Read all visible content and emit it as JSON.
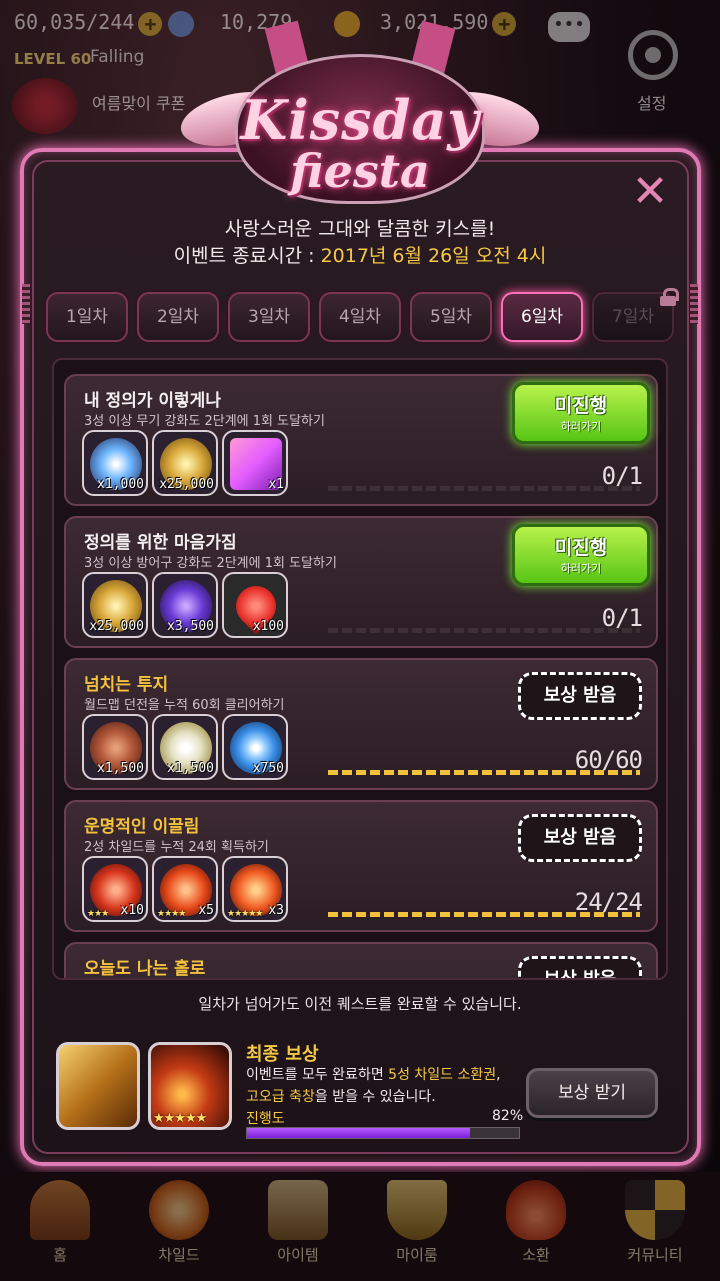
{
  "hud": {
    "resource1": "60,035/244",
    "resource2": "10,279",
    "resource3": "3,021,590",
    "level_label": "LEVEL 60",
    "player_name": "Falling",
    "event_banner": "여름맞이 쿠폰",
    "settings_label": "설정"
  },
  "event": {
    "logo_line1": "Kissday",
    "logo_line2": "fiesta",
    "subtitle": "사랑스러운 그대와 달콤한 키스를!",
    "end_label": "이벤트 종료시간 : ",
    "end_time": "2017년 6월 26일 오전 4시",
    "close_symbol": "✕"
  },
  "tabs": [
    {
      "label": "1일차",
      "state": "normal"
    },
    {
      "label": "2일차",
      "state": "normal"
    },
    {
      "label": "3일차",
      "state": "normal"
    },
    {
      "label": "4일차",
      "state": "normal"
    },
    {
      "label": "5일차",
      "state": "normal"
    },
    {
      "label": "6일차",
      "state": "active"
    },
    {
      "label": "7일차",
      "state": "locked"
    }
  ],
  "quests": [
    {
      "title": "내 정의가 이렇게나",
      "desc": "3성 이상 무기 강화도 2단계에 1회 도달하기",
      "status": "incomplete",
      "button": {
        "main": "미진행",
        "sub": "하러가기"
      },
      "progress_text": "0/1",
      "progress": 0,
      "rewards": [
        {
          "icon": "rainbow-gem-icon",
          "count": "x1,000",
          "color": "#6fb6ff"
        },
        {
          "icon": "gold-coins-icon",
          "count": "x25,000",
          "color": "#d9a83a"
        },
        {
          "icon": "ticket-card-icon",
          "count": "x1",
          "color": "#e45cff"
        }
      ]
    },
    {
      "title": "정의를 위한 마음가짐",
      "desc": "3성 이상 방어구 강화도 2단계에 1회 도달하기",
      "status": "incomplete",
      "button": {
        "main": "미진행",
        "sub": "하러가기"
      },
      "progress_text": "0/1",
      "progress": 0,
      "rewards": [
        {
          "icon": "gold-coins-icon",
          "count": "x25,000",
          "color": "#d9a83a"
        },
        {
          "icon": "purple-crystal-icon",
          "count": "x3,500",
          "color": "#6a3bd6"
        },
        {
          "icon": "heart-icon",
          "count": "x100",
          "color": "#e8312b"
        }
      ]
    },
    {
      "title": "넘치는 투지",
      "desc": "월드맵 던전을 누적 60회 클리어하기",
      "status": "complete",
      "button": {
        "main": "보상 받음"
      },
      "progress_text": "60/60",
      "progress": 1,
      "rewards": [
        {
          "icon": "bronze-medal-icon",
          "count": "x1,500",
          "color": "#b2573a"
        },
        {
          "icon": "silver-coin-icon",
          "count": "x1,500",
          "color": "#e6e2c6"
        },
        {
          "icon": "blue-orb-icon",
          "count": "x750",
          "color": "#3a8ee6"
        }
      ]
    },
    {
      "title": "운명적인 이끌림",
      "desc": "2성 차일드를 누적 24회 획득하기",
      "status": "complete",
      "button": {
        "main": "보상 받음"
      },
      "progress_text": "24/24",
      "progress": 1,
      "rewards": [
        {
          "icon": "red-gem-icon",
          "count": "x10",
          "stars": "★★★",
          "color": "#d8361e"
        },
        {
          "icon": "red-gem-icon",
          "count": "x5",
          "stars": "★★★★",
          "color": "#e84a1a"
        },
        {
          "icon": "red-gem-icon",
          "count": "x3",
          "stars": "★★★★★",
          "color": "#f05a22"
        }
      ]
    },
    {
      "title": "오늘도 나는 홀로",
      "desc": "",
      "status": "complete",
      "button": {
        "main": "보상 받음"
      },
      "progress_text": "",
      "progress": 1,
      "rewards": []
    }
  ],
  "note": "일차가 넘어가도 이전 퀘스트를 완료할 수 있습니다.",
  "final_reward": {
    "title": "최종 보상",
    "desc_pre": "이벤트를 모두 완료하면 ",
    "desc_hl1": "5성 차일드 소환권",
    "desc_mid": ",",
    "desc_hl2": "고오급 축창",
    "desc_post": "을 받을 수 있습니다.",
    "progress_label": "진행도",
    "progress_text": "82%",
    "progress": 0.82,
    "button": "보상 받기",
    "card2_stars": "★★★★★"
  },
  "nav": [
    {
      "label": "홈",
      "icon": "home-gate-icon"
    },
    {
      "label": "차일드",
      "icon": "child-flame-icon"
    },
    {
      "label": "아이템",
      "icon": "item-sword-shield-icon"
    },
    {
      "label": "마이룸",
      "icon": "myroom-crown-icon"
    },
    {
      "label": "소환",
      "icon": "summon-flask-icon"
    },
    {
      "label": "커뮤니티",
      "icon": "community-shield-icon"
    }
  ],
  "colors": {
    "accent_pink": "#ff6fb7",
    "gold": "#f6c945",
    "green_button": "#57c514",
    "progress_purple": "#7a1fd6"
  }
}
